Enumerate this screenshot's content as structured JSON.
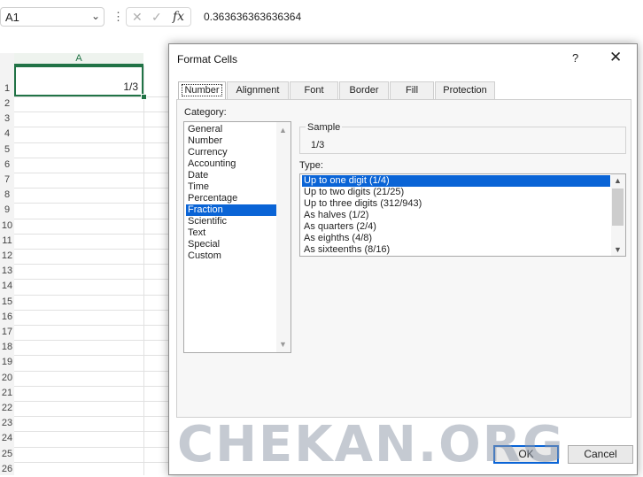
{
  "formula_bar": {
    "name_box": "A1",
    "name_box_arrow": "⌄",
    "dots": "⋮",
    "cancel_glyph": "✕",
    "enter_glyph": "✓",
    "fx_label": "fx",
    "formula_value": "0.363636363636364"
  },
  "sheet": {
    "column_header": "A",
    "row_numbers": [
      "1",
      "2",
      "3",
      "4",
      "5",
      "6",
      "7",
      "8",
      "9",
      "10",
      "11",
      "12",
      "13",
      "14",
      "15",
      "16",
      "17",
      "18",
      "19",
      "20",
      "21",
      "22",
      "23",
      "24",
      "25",
      "26"
    ],
    "a1_value": "1/3",
    "accent_color": "#217346"
  },
  "dialog": {
    "title": "Format Cells",
    "help": "?",
    "close": "✕",
    "tabs": [
      "Number",
      "Alignment",
      "Font",
      "Border",
      "Fill",
      "Protection"
    ],
    "active_tab": "Number",
    "category_label": "Category:",
    "categories": [
      "General",
      "Number",
      "Currency",
      "Accounting",
      "Date",
      "Time",
      "Percentage",
      "Fraction",
      "Scientific",
      "Text",
      "Special",
      "Custom"
    ],
    "selected_category": "Fraction",
    "sample_label": "Sample",
    "sample_value": "1/3",
    "type_label": "Type:",
    "types": [
      "Up to one digit (1/4)",
      "Up to two digits (21/25)",
      "Up to three digits (312/943)",
      "As halves (1/2)",
      "As quarters (2/4)",
      "As eighths (4/8)",
      "As sixteenths (8/16)"
    ],
    "selected_type": "Up to one digit (1/4)",
    "ok_label": "OK",
    "cancel_label": "Cancel",
    "selection_color": "#0a64d6"
  },
  "watermark": "CHEKAN.ORG"
}
